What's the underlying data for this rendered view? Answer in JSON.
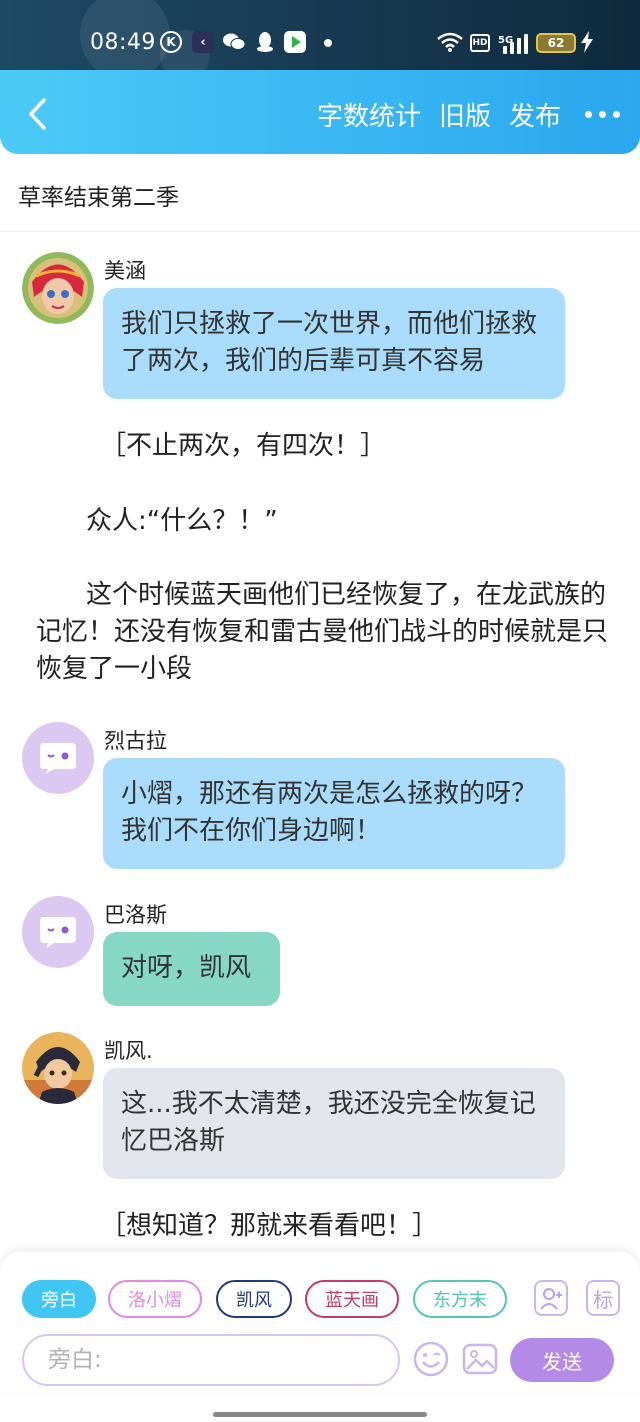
{
  "status_bar": {
    "time": "08:49",
    "k_label": "K",
    "network": "5G",
    "hd_label": "HD",
    "battery": "62"
  },
  "header": {
    "actions": [
      "字数统计",
      "旧版",
      "发布"
    ]
  },
  "document": {
    "title": "草率结束第二季"
  },
  "messages": [
    {
      "speaker": "美涵",
      "text": "我们只拯救了一次世界，而他们拯救了两次，我们的后辈可真不容易",
      "style": "blue"
    },
    {
      "speaker": "烈古拉",
      "text": "小熠，那还有两次是怎么拯救的呀？我们不在你们身边啊！",
      "style": "blue"
    },
    {
      "speaker": "巴洛斯",
      "text": "对呀，凯风",
      "style": "green"
    },
    {
      "speaker": "凯风.",
      "text": "这...我不太清楚，我还没完全恢复记忆巴洛斯",
      "style": "grey"
    }
  ],
  "narrations": [
    "［不止两次，有四次！］",
    "众人:“什么？！”",
    "这个时候蓝天画他们已经恢复了，在龙武族的记忆！还没有恢复和雷古曼他们战斗的时候就是只恢复了一小段",
    "［想知道？那就来看看吧！］"
  ],
  "toolbar": {
    "roles": [
      {
        "label": "旁白",
        "color": "#3fc6f3",
        "active": true
      },
      {
        "label": "洛小熠",
        "color": "#e08ae6",
        "active": false
      },
      {
        "label": "凯风",
        "color": "#1f3c7a",
        "active": false
      },
      {
        "label": "蓝天画",
        "color": "#c23b6a",
        "active": false
      },
      {
        "label": "东方末",
        "color": "#4fc7b4",
        "active": false
      }
    ],
    "mark_label": "标",
    "input_placeholder": "旁白:",
    "send_label": "发送"
  }
}
